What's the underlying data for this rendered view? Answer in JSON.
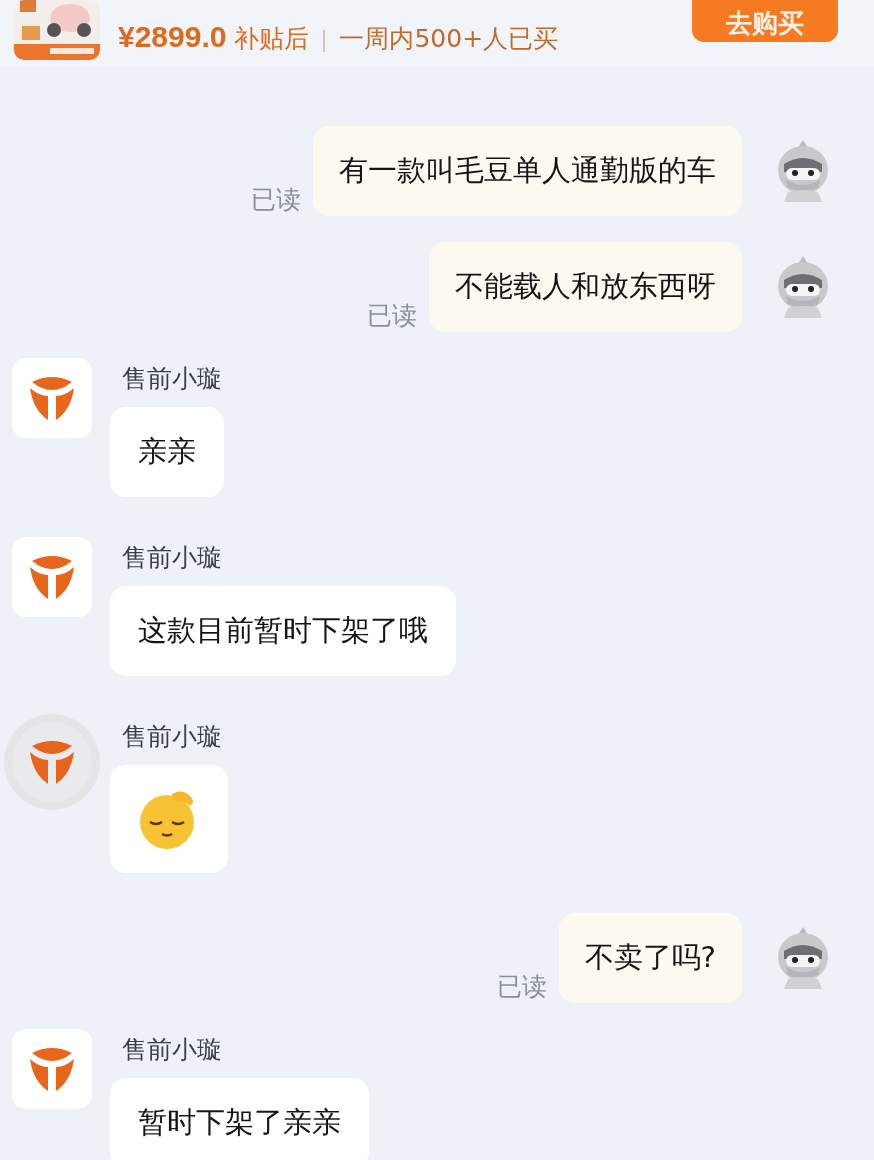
{
  "product_bar": {
    "price": "¥2899.0",
    "price_note": "补贴后",
    "sales": "一周内500+人已买",
    "buy_button": "去购买"
  },
  "messages": [
    {
      "kind": "sent",
      "text": "有一款叫毛豆单人通勤版的车",
      "status": "已读"
    },
    {
      "kind": "sent",
      "text": "不能载人和放东西呀",
      "status": "已读"
    },
    {
      "kind": "received",
      "sender": "售前小璇",
      "text": "亲亲",
      "avatar_ring": false
    },
    {
      "kind": "received",
      "sender": "售前小璇",
      "text": "这款目前暂时下架了哦",
      "avatar_ring": false
    },
    {
      "kind": "received_emoji",
      "sender": "售前小璇",
      "avatar_ring": true
    },
    {
      "kind": "sent",
      "text": "不卖了吗?",
      "status": "已读"
    },
    {
      "kind": "received",
      "sender": "售前小璇",
      "text": "暂时下架了亲亲",
      "avatar_ring": false
    }
  ]
}
